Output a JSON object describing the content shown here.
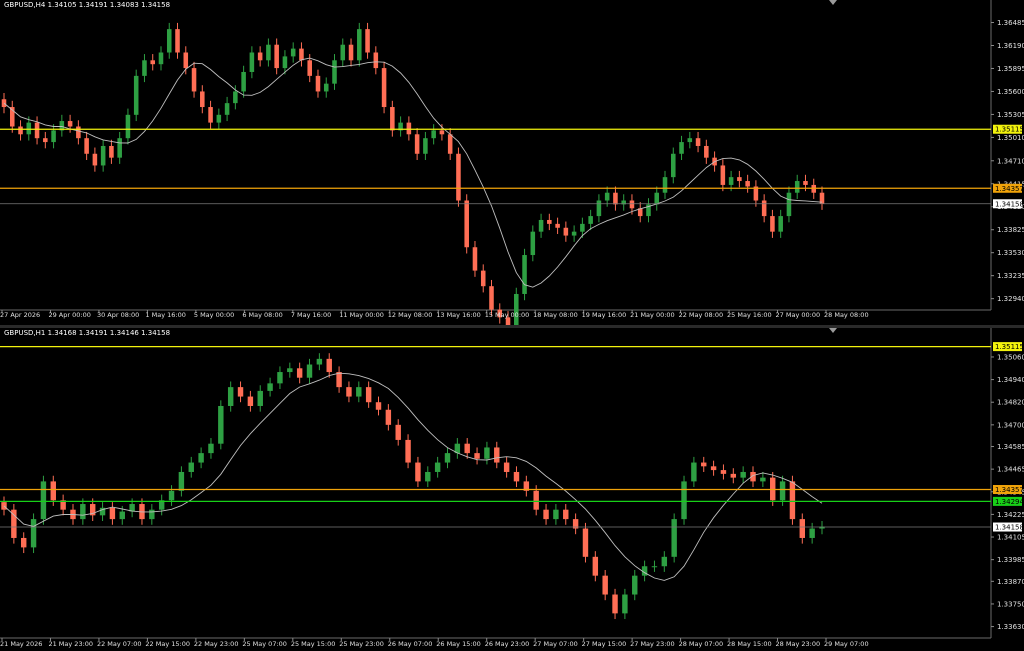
{
  "colors": {
    "bull": "#2ea043",
    "bear": "#ff6e55",
    "ma": "#bfbfbf",
    "yellow": "#f2f20d",
    "orange": "#f0a30a",
    "green": "#18d018",
    "grid": "#555555",
    "bid": "#7a7a7a"
  },
  "panels": [
    {
      "title": "GBPUSD,H4  1.34105 1.34191 1.34083 1.34158",
      "ticks": [
        "1.36485",
        "1.36190",
        "1.35895",
        "1.35600",
        "1.35305",
        "1.35010",
        "1.34710",
        "1.34415",
        "1.34120",
        "1.33825",
        "1.33530",
        "1.33235",
        "1.32940"
      ],
      "tick_values": [
        1.36485,
        1.3619,
        1.35895,
        1.356,
        1.35305,
        1.3501,
        1.3471,
        1.34415,
        1.3412,
        1.33825,
        1.3353,
        1.33235,
        1.3294
      ],
      "price_range": [
        1.3282,
        1.3662
      ],
      "xlabels": [
        "27 Apr 2026",
        "29 Apr 00:00",
        "30 Apr 08:00",
        "1 May 16:00",
        "5 May 00:00",
        "6 May 08:00",
        "7 May 16:00",
        "11 May 00:00",
        "12 May 08:00",
        "13 May 16:00",
        "15 May 00:00",
        "18 May 08:00",
        "19 May 16:00",
        "21 May 00:00",
        "22 May 08:00",
        "25 May 16:00",
        "27 May 00:00",
        "28 May 08:00"
      ],
      "levels": [
        {
          "label": "1.35115",
          "value": 1.35115,
          "color": "yellow"
        },
        {
          "label": "1.34357",
          "value": 1.34357,
          "color": "orange"
        },
        {
          "label": "1.34158",
          "value": 1.34158,
          "color": "bid"
        }
      ],
      "closes": [
        1.354,
        1.3515,
        1.3505,
        1.352,
        1.35,
        1.3495,
        1.351,
        1.3522,
        1.3515,
        1.35,
        1.348,
        1.3465,
        1.349,
        1.3475,
        1.35,
        1.353,
        1.358,
        1.36,
        1.3595,
        1.361,
        1.364,
        1.361,
        1.359,
        1.356,
        1.354,
        1.352,
        1.353,
        1.3545,
        1.356,
        1.3585,
        1.361,
        1.36,
        1.362,
        1.359,
        1.3605,
        1.3615,
        1.36,
        1.358,
        1.356,
        1.357,
        1.36,
        1.362,
        1.36,
        1.364,
        1.361,
        1.359,
        1.354,
        1.351,
        1.352,
        1.3505,
        1.348,
        1.35,
        1.351,
        1.3505,
        1.348,
        1.342,
        1.336,
        1.333,
        1.331,
        1.328,
        1.327,
        1.326,
        1.33,
        1.335,
        1.338,
        1.3395,
        1.339,
        1.3385,
        1.3375,
        1.338,
        1.339,
        1.34,
        1.342,
        1.343,
        1.3415,
        1.342,
        1.341,
        1.34,
        1.3415,
        1.343,
        1.345,
        1.348,
        1.3495,
        1.35,
        1.349,
        1.3475,
        1.3465,
        1.344,
        1.345,
        1.3445,
        1.3438,
        1.342,
        1.34,
        1.338,
        1.34,
        1.343,
        1.3445,
        1.344,
        1.343,
        1.3416
      ]
    },
    {
      "title": "GBPUSD,H1  1.34168 1.34191 1.34146 1.34158",
      "ticks": [
        "1.35060",
        "1.34940",
        "1.34820",
        "1.34700",
        "1.34585",
        "1.34465",
        "1.34345",
        "1.34225",
        "1.34105",
        "1.33985",
        "1.33870",
        "1.33750",
        "1.33630"
      ],
      "tick_values": [
        1.3506,
        1.3494,
        1.3482,
        1.347,
        1.34585,
        1.34465,
        1.34345,
        1.34225,
        1.34105,
        1.33985,
        1.3387,
        1.3375,
        1.3363
      ],
      "price_range": [
        1.3358,
        1.3515
      ],
      "xlabels": [
        "21 May 2026",
        "21 May 23:00",
        "22 May 07:00",
        "22 May 15:00",
        "22 May 23:00",
        "25 May 07:00",
        "25 May 15:00",
        "25 May 23:00",
        "26 May 07:00",
        "26 May 15:00",
        "26 May 23:00",
        "27 May 07:00",
        "27 May 15:00",
        "27 May 23:00",
        "28 May 07:00",
        "28 May 15:00",
        "28 May 23:00",
        "29 May 07:00"
      ],
      "levels": [
        {
          "label": "1.35115",
          "value": 1.35115,
          "color": "yellow"
        },
        {
          "label": "1.34357",
          "value": 1.34357,
          "color": "orange"
        },
        {
          "label": "1.34294",
          "value": 1.34294,
          "color": "green"
        },
        {
          "label": "1.34158",
          "value": 1.34158,
          "color": "bid"
        }
      ],
      "closes": [
        1.3425,
        1.341,
        1.3405,
        1.342,
        1.344,
        1.343,
        1.3425,
        1.342,
        1.3428,
        1.3422,
        1.3426,
        1.342,
        1.3424,
        1.3428,
        1.342,
        1.3425,
        1.343,
        1.3435,
        1.3445,
        1.345,
        1.3455,
        1.346,
        1.348,
        1.349,
        1.3485,
        1.348,
        1.3488,
        1.3492,
        1.3498,
        1.35,
        1.3495,
        1.3502,
        1.3505,
        1.3498,
        1.349,
        1.3485,
        1.349,
        1.3482,
        1.3478,
        1.347,
        1.3462,
        1.345,
        1.344,
        1.3445,
        1.345,
        1.3455,
        1.346,
        1.3455,
        1.3452,
        1.3458,
        1.345,
        1.3445,
        1.344,
        1.3435,
        1.3425,
        1.342,
        1.3425,
        1.342,
        1.3415,
        1.34,
        1.339,
        1.338,
        1.337,
        1.338,
        1.339,
        1.3395,
        1.3395,
        1.34,
        1.342,
        1.344,
        1.345,
        1.3448,
        1.3446,
        1.3444,
        1.3442,
        1.3445,
        1.344,
        1.3442,
        1.343,
        1.344,
        1.342,
        1.341,
        1.3415,
        1.3416
      ]
    }
  ]
}
